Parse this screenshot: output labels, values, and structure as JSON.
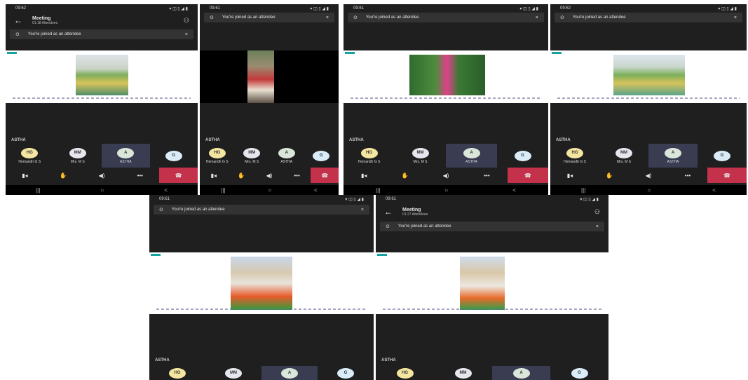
{
  "common": {
    "notice": "You're joined as an attendee",
    "presenter_section": "ASTHA",
    "back_icon": "←",
    "people_icon": "⚇",
    "close_icon": "×",
    "notice_icon": "⊙",
    "participants": [
      {
        "initials": "HG",
        "name": "Hemandh G S",
        "color": "#f4e6a0"
      },
      {
        "initials": "MM",
        "name": "Mrs. M S",
        "color": "#e6e6ee"
      },
      {
        "initials": "A",
        "name": "ASTHA",
        "color": "#d9e6d9"
      },
      {
        "initials": "G",
        "name": "",
        "color": "#d9ecf7"
      }
    ],
    "controls": [
      {
        "name": "video-off-icon",
        "glyph": "▮◂"
      },
      {
        "name": "hand-raise-icon",
        "glyph": "✋"
      },
      {
        "name": "speaker-icon",
        "glyph": "◀)"
      },
      {
        "name": "more-icon",
        "glyph": "•••"
      },
      {
        "name": "hang-up-icon",
        "glyph": "☎"
      }
    ],
    "navbar": [
      "|||",
      "○",
      "<"
    ]
  },
  "phones": [
    {
      "time": "09:62",
      "status": "▾ ◫ ▯ ◢ ▮",
      "meeting": {
        "title": "Meeting",
        "sub": "01:18 Attendees"
      }
    },
    {
      "time": "09:61",
      "status": "▾ ◫ ▯ ◢ ▮"
    },
    {
      "time": "09:61",
      "status": "▾ ◫ ▯ ◢ ▮"
    },
    {
      "time": "09:62",
      "status": "▾ ◫ ▯ ◢ ▮"
    },
    {
      "time": "09:61",
      "status": "▾ ◫ ▯ ◢ ▮"
    },
    {
      "time": "09:61",
      "status": "▾ ◫ ▯ ◢ ▮",
      "meeting": {
        "title": "Meeting",
        "sub": "01:27 Attendees"
      }
    }
  ]
}
